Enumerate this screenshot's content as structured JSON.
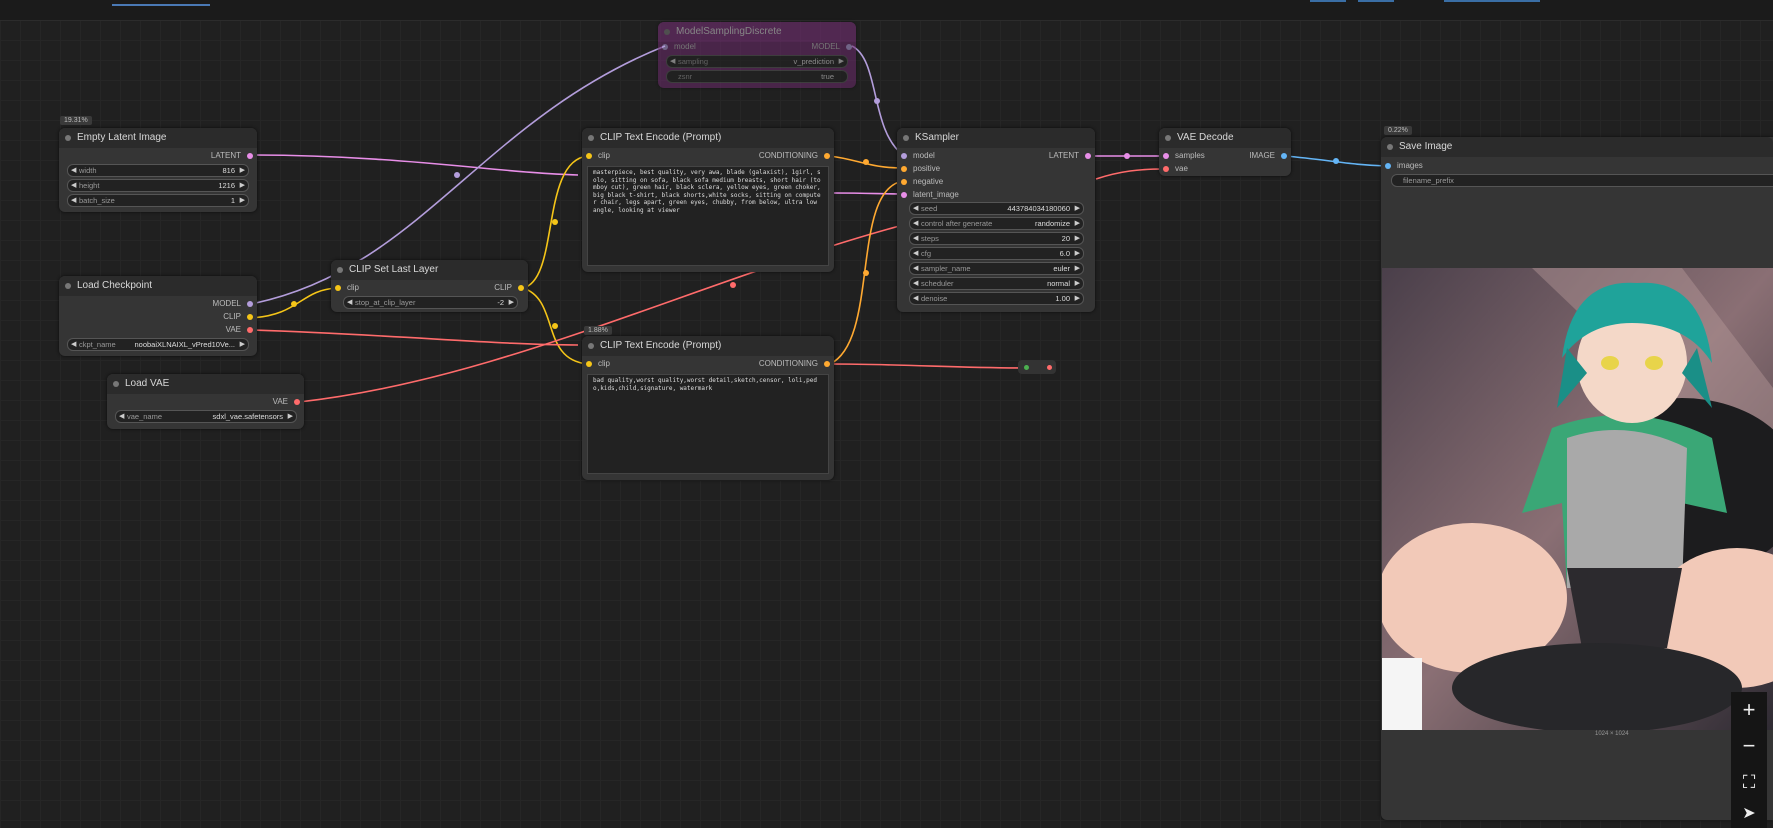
{
  "canvas": {
    "background": "#202020"
  },
  "link_colors": {
    "latent": "#e88ee8",
    "model": "#b39ddb",
    "clip": "#f5c518",
    "vae": "#ff6b6b",
    "conditioning": "#ffa931",
    "image": "#64b5f6"
  },
  "nodes": {
    "model_sampling": {
      "title": "ModelSamplingDiscrete",
      "input": "model",
      "output": "MODEL",
      "widgets": [
        {
          "label": "sampling",
          "value": "v_prediction"
        },
        {
          "label": "zsnr",
          "value": "true"
        }
      ]
    },
    "empty_latent": {
      "badge": "19.31%",
      "title": "Empty Latent Image",
      "output": "LATENT",
      "widgets": [
        {
          "label": "width",
          "value": "816"
        },
        {
          "label": "height",
          "value": "1216"
        },
        {
          "label": "batch_size",
          "value": "1"
        }
      ]
    },
    "load_checkpoint": {
      "title": "Load Checkpoint",
      "outputs": [
        "MODEL",
        "CLIP",
        "VAE"
      ],
      "widgets": [
        {
          "label": "ckpt_name",
          "value": "noobaiXLNAIXL_vPred10Ve..."
        }
      ]
    },
    "load_vae": {
      "title": "Load VAE",
      "output": "VAE",
      "widgets": [
        {
          "label": "vae_name",
          "value": "sdxl_vae.safetensors"
        }
      ]
    },
    "clip_set_last_layer": {
      "title": "CLIP Set Last Layer",
      "input": "clip",
      "output": "CLIP",
      "widgets": [
        {
          "label": "stop_at_clip_layer",
          "value": "-2"
        }
      ]
    },
    "clip_pos": {
      "title": "CLIP Text Encode (Prompt)",
      "input": "clip",
      "output": "CONDITIONING",
      "text": "masterpiece, best quality, very awa,  blade (galaxist), 1girl, solo, sitting on sofa, black sofa medium breasts, short hair (tomboy cut), green hair, black sclera, yellow eyes, green choker, big black t-shirt, black shorts,white socks, sitting on computer chair, legs apart, green eyes, chubby, from below, ultra low angle, looking at viewer"
    },
    "clip_neg": {
      "badge": "1.88%",
      "title": "CLIP Text Encode (Prompt)",
      "input": "clip",
      "output": "CONDITIONING",
      "text": "bad quality,worst quality,worst detail,sketch,censor, loli,pedo,kids,child,signature, watermark"
    },
    "ksampler": {
      "title": "KSampler",
      "inputs": [
        "model",
        "positive",
        "negative",
        "latent_image"
      ],
      "output": "LATENT",
      "widgets": [
        {
          "label": "seed",
          "value": "443784034180060"
        },
        {
          "label": "control after generate",
          "value": "randomize"
        },
        {
          "label": "steps",
          "value": "20"
        },
        {
          "label": "cfg",
          "value": "6.0"
        },
        {
          "label": "sampler_name",
          "value": "euler"
        },
        {
          "label": "scheduler",
          "value": "normal"
        },
        {
          "label": "denoise",
          "value": "1.00"
        }
      ]
    },
    "vae_decode": {
      "title": "VAE Decode",
      "inputs": [
        "samples",
        "vae"
      ],
      "output": "IMAGE"
    },
    "save_image": {
      "badge": "0.22%",
      "title": "Save Image",
      "input": "images",
      "widgets": [
        {
          "label": "filename_prefix",
          "value": ""
        }
      ],
      "image_size": "1024 × 1024"
    }
  },
  "zoom_controls": [
    {
      "name": "zoom-in",
      "glyph": "+"
    },
    {
      "name": "zoom-out",
      "glyph": "−"
    },
    {
      "name": "fit-view",
      "glyph": "⛶"
    },
    {
      "name": "locate",
      "glyph": "➤"
    }
  ]
}
